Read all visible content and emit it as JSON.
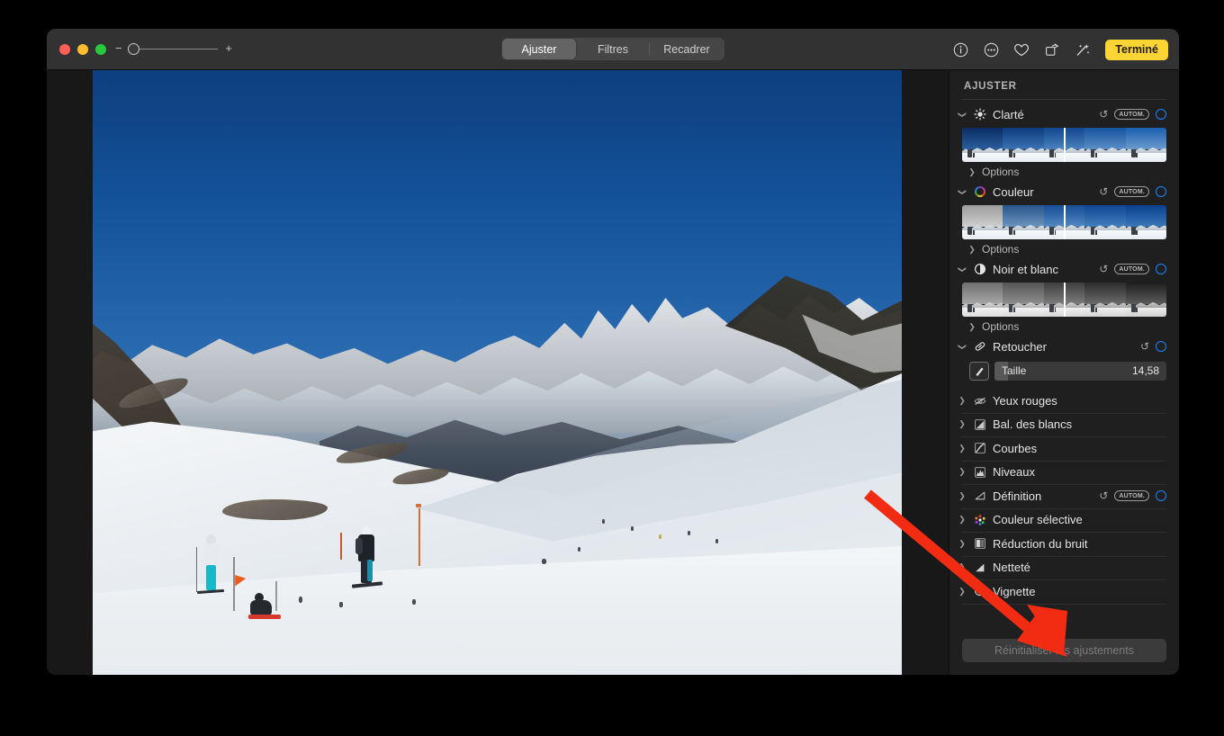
{
  "window": {
    "traffic_lights": [
      "close",
      "minimize",
      "maximize"
    ],
    "zoom": {
      "minus": "−",
      "plus": "+"
    }
  },
  "toolbar": {
    "segments": [
      {
        "label": "Ajuster",
        "active": true
      },
      {
        "label": "Filtres",
        "active": false
      },
      {
        "label": "Recadrer",
        "active": false
      }
    ],
    "icons": [
      "info-icon",
      "more-options-icon",
      "favorite-heart-icon",
      "rotate-icon",
      "magic-wand-icon"
    ],
    "done_label": "Terminé"
  },
  "sidebar": {
    "title": "AJUSTER",
    "sections": [
      {
        "id": "clarte",
        "label": "Clarté",
        "icon": "brightness-icon",
        "expanded": true,
        "has_revert": true,
        "has_auto": true,
        "auto_label": "AUTOM.",
        "has_toggle_ring": true,
        "thumbnails": true,
        "thumb_theme": "color",
        "options_label": "Options"
      },
      {
        "id": "couleur",
        "label": "Couleur",
        "icon": "color-wheel-icon",
        "expanded": true,
        "has_revert": true,
        "has_auto": true,
        "auto_label": "AUTOM.",
        "has_toggle_ring": true,
        "thumbnails": true,
        "thumb_theme": "saturation",
        "options_label": "Options"
      },
      {
        "id": "noir-et-blanc",
        "label": "Noir et blanc",
        "icon": "contrast-circle-icon",
        "expanded": true,
        "has_revert": true,
        "has_auto": true,
        "auto_label": "AUTOM.",
        "has_toggle_ring": true,
        "thumbnails": true,
        "thumb_theme": "mono",
        "options_label": "Options"
      },
      {
        "id": "retoucher",
        "label": "Retoucher",
        "icon": "retouch-bandage-icon",
        "expanded": true,
        "has_revert": true,
        "has_auto": false,
        "has_toggle_ring": true,
        "slider": {
          "icon": "brush-icon",
          "name": "Taille",
          "value": "14,58",
          "fill_percent": 8
        }
      }
    ],
    "collapsed_rows": [
      {
        "id": "yeux-rouges",
        "label": "Yeux rouges",
        "icon": "red-eye-icon",
        "has_revert": false,
        "has_auto": false,
        "has_toggle_ring": false
      },
      {
        "id": "bal-des-blancs",
        "label": "Bal. des blancs",
        "icon": "white-balance-icon",
        "has_revert": false,
        "has_auto": false,
        "has_toggle_ring": false
      },
      {
        "id": "courbes",
        "label": "Courbes",
        "icon": "curves-icon",
        "has_revert": false,
        "has_auto": false,
        "has_toggle_ring": false
      },
      {
        "id": "niveaux",
        "label": "Niveaux",
        "icon": "levels-icon",
        "has_revert": false,
        "has_auto": false,
        "has_toggle_ring": false
      },
      {
        "id": "definition",
        "label": "Définition",
        "icon": "definition-icon",
        "has_revert": true,
        "has_auto": true,
        "auto_label": "AUTOM.",
        "has_toggle_ring": true
      },
      {
        "id": "couleur-selective",
        "label": "Couleur sélective",
        "icon": "selective-color-icon",
        "has_revert": false,
        "has_auto": false,
        "has_toggle_ring": false
      },
      {
        "id": "reduction-du-bruit",
        "label": "Réduction du bruit",
        "icon": "noise-reduction-icon",
        "has_revert": false,
        "has_auto": false,
        "has_toggle_ring": false
      },
      {
        "id": "nettete",
        "label": "Netteté",
        "icon": "sharpen-icon",
        "has_revert": false,
        "has_auto": false,
        "has_toggle_ring": false
      },
      {
        "id": "vignette",
        "label": "Vignette",
        "icon": "vignette-icon",
        "has_revert": false,
        "has_auto": false,
        "has_toggle_ring": false
      }
    ],
    "reset_label": "Réinitialiser les ajustements"
  },
  "photo": {
    "description": "Ski slope panorama with snow-covered alpine mountains under a deep blue sky, skiers in the foreground"
  },
  "annotation": {
    "arrow_color": "#f22b13",
    "points_to": "reset-adjustments-button"
  },
  "colors": {
    "accent_yellow": "#fcd535",
    "accent_blue": "#1a85ff",
    "arrow_red": "#f22b13",
    "window_bg": "#1e1e1e",
    "toolbar_bg": "#323232",
    "sidebar_bg": "#1f1f1f"
  }
}
